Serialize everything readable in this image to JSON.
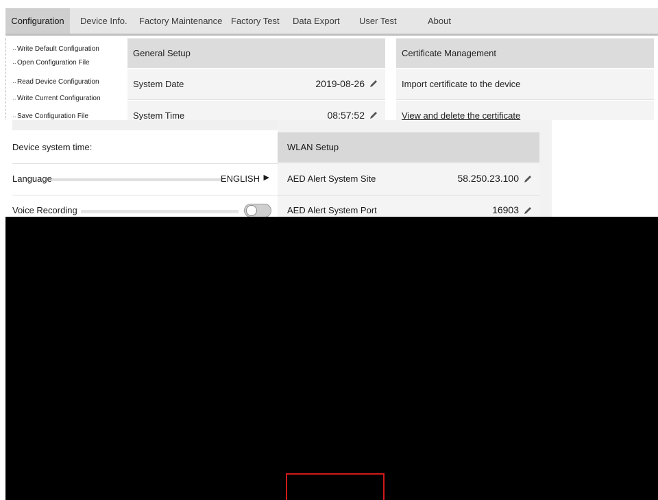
{
  "tabs": [
    {
      "label": "Configuration",
      "active": true
    },
    {
      "label": "Device Info."
    },
    {
      "label": "Factory Maintenance"
    },
    {
      "label": "Factory Test"
    },
    {
      "label": "Data Export"
    },
    {
      "label": "User Test"
    },
    {
      "label": "About"
    }
  ],
  "menu": [
    "Write Default Configuration",
    "Open Configuration File",
    "Read Device Configuration",
    "Write Current Configuration",
    "Save Configuration File"
  ],
  "general_setup": {
    "title": "General Setup",
    "system_date_label": "System Date",
    "system_date_value": "2019-08-26",
    "system_time_label": "System Time",
    "system_time_value": "08:57:52"
  },
  "certificate": {
    "title": "Certificate Management",
    "import_label": "Import certificate to the device",
    "view_label": "View and delete the certificate"
  },
  "overlay": {
    "device_time_label": "Device system time:",
    "language_label": "Language",
    "language_value": "ENGLISH",
    "voice_label": "Voice Recording",
    "wlan_title": "WLAN Setup",
    "aed_site_label": "AED Alert System Site",
    "aed_site_value": "58.250.23.100",
    "aed_port_label": "AED Alert System Port",
    "aed_port_value": "16903"
  },
  "colors": {
    "accent_red": "#d21a1a",
    "panel_gray": "#dcdcdc"
  }
}
